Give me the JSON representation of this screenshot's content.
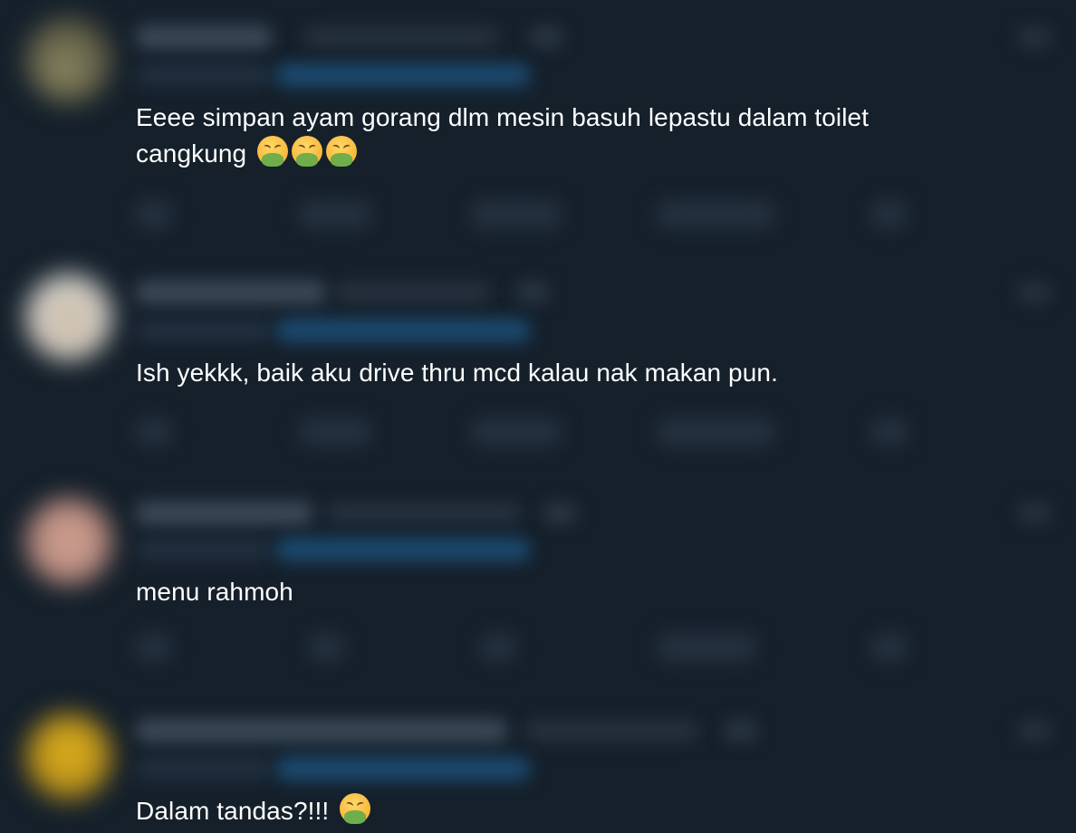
{
  "replies": [
    {
      "text": "Eeee simpan ayam gorang dlm mesin basuh lepastu dalam toilet cangkung",
      "emojis": [
        "face-vomiting-emoji",
        "face-vomiting-emoji",
        "face-vomiting-emoji"
      ],
      "avatar_color": "#6f6a52"
    },
    {
      "text": "Ish yekkk, baik aku drive thru mcd kalau nak makan pun.",
      "emojis": [],
      "avatar_color": "#c9c2b6"
    },
    {
      "text": "menu rahmoh",
      "emojis": [],
      "avatar_color": "#c69a8e"
    },
    {
      "text": "Dalam tandas?!!!",
      "emojis": [
        "face-vomiting-emoji"
      ],
      "avatar_color": "#c49a18"
    }
  ],
  "colors": {
    "background": "#15202b",
    "text": "#ffffff",
    "blurred_link": "#1b4a70"
  }
}
